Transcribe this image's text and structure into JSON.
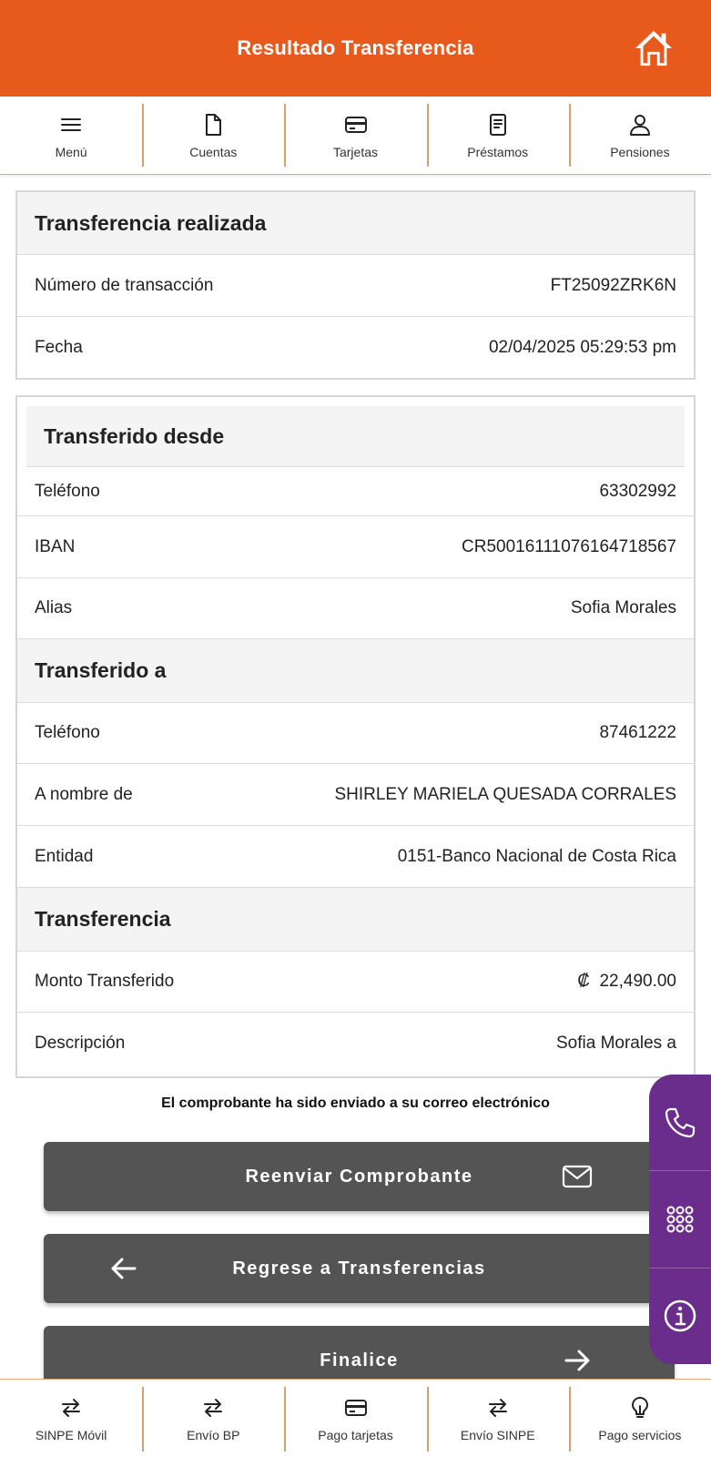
{
  "header": {
    "title": "Resultado Transferencia",
    "icon": "home-icon",
    "background": "#E85A1C"
  },
  "top_nav": [
    {
      "label": "Menú",
      "icon": "menu-icon"
    },
    {
      "label": "Cuentas",
      "icon": "document-icon"
    },
    {
      "label": "Tarjetas",
      "icon": "card-icon"
    },
    {
      "label": "Préstamos",
      "icon": "receipt-icon"
    },
    {
      "label": "Pensiones",
      "icon": "person-icon"
    }
  ],
  "summary": {
    "title": "Transferencia realizada",
    "rows": [
      {
        "label": "Número de transacción",
        "value": "FT25092ZRK6N"
      },
      {
        "label": "Fecha",
        "value": "02/04/2025 05:29:53 pm"
      }
    ]
  },
  "from": {
    "title": "Transferido desde",
    "rows": [
      {
        "label": "Teléfono",
        "value": "63302992"
      },
      {
        "label": "IBAN",
        "value": "CR50016111076164718567"
      },
      {
        "label": "Alias",
        "value": "Sofia Morales"
      }
    ]
  },
  "to": {
    "title": "Transferido a",
    "rows": [
      {
        "label": "Teléfono",
        "value": "87461222"
      },
      {
        "label": "A nombre de",
        "value": "SHIRLEY MARIELA QUESADA CORRALES"
      },
      {
        "label": "Entidad",
        "value": "0151-Banco Nacional de Costa Rica"
      }
    ]
  },
  "transfer": {
    "title": "Transferencia",
    "rows": [
      {
        "label": "Monto Transferido",
        "value": "₡  22,490.00"
      },
      {
        "label": "Descripción",
        "value": "Sofia Morales a"
      }
    ]
  },
  "notice": "El comprobante ha sido enviado a su correo electrónico",
  "actions": {
    "resend_label": "Reenviar Comprobante",
    "back_label": "Regrese a Transferencias",
    "finish_label": "Finalice"
  },
  "side_panel": {
    "icons": [
      "phone-icon",
      "keypad-icon",
      "info-icon"
    ],
    "color": "#6B2D8B"
  },
  "bottom_nav": [
    {
      "label": "SINPE Móvil",
      "icon": "transfer-arrows-icon"
    },
    {
      "label": "Envío BP",
      "icon": "transfer-arrows-icon"
    },
    {
      "label": "Pago tarjetas",
      "icon": "card-icon"
    },
    {
      "label": "Envío SINPE",
      "icon": "transfer-arrows-icon"
    },
    {
      "label": "Pago servicios",
      "icon": "lightbulb-icon"
    }
  ]
}
